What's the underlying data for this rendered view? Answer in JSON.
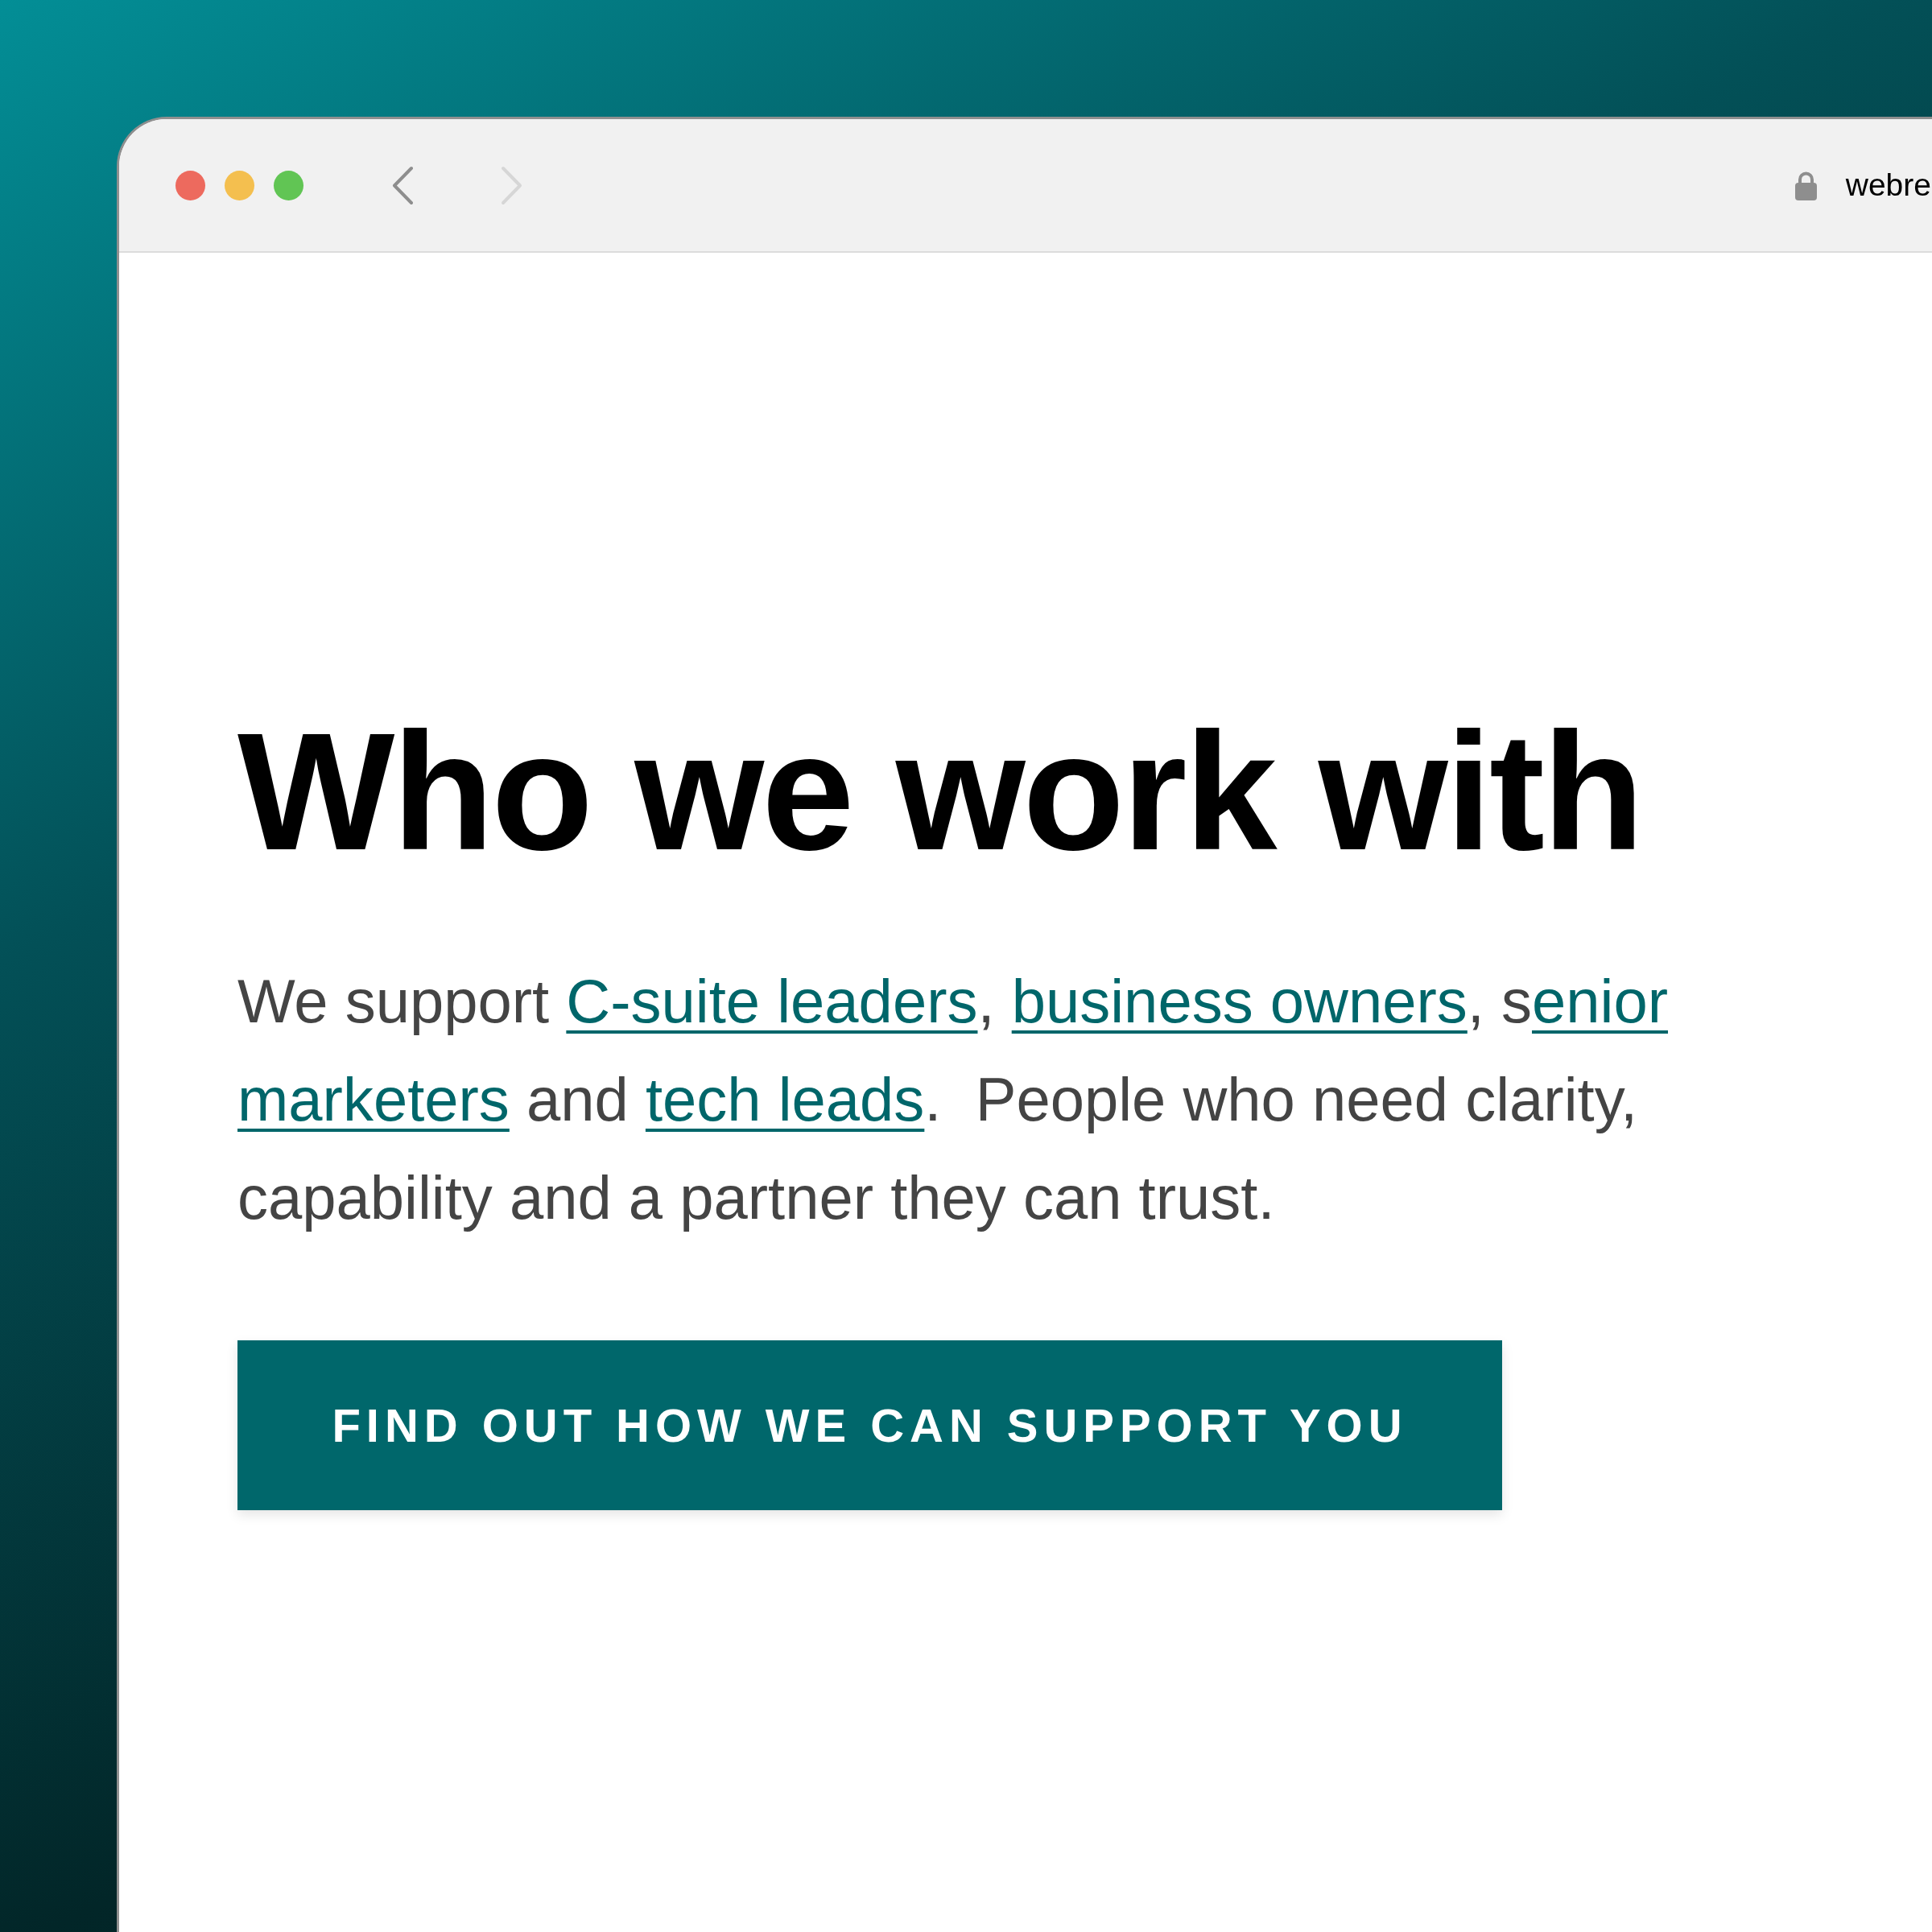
{
  "browser": {
    "traffic_lights": [
      {
        "color": "#ed6a5e"
      },
      {
        "color": "#f4bf4f"
      },
      {
        "color": "#61c554"
      }
    ],
    "back": {
      "disabled": false
    },
    "forward": {
      "disabled": true
    },
    "address": {
      "url": "webre"
    }
  },
  "content": {
    "heading": "Who we work with",
    "paragraph": [
      {
        "kind": "text",
        "text": "We support "
      },
      {
        "kind": "link",
        "text": "C-suite leaders"
      },
      {
        "kind": "text",
        "text": ", "
      },
      {
        "kind": "link",
        "text": "business owners"
      },
      {
        "kind": "text",
        "text": ", s"
      },
      {
        "kind": "link",
        "text": "enior "
      },
      {
        "kind": "link",
        "text": "marketers"
      },
      {
        "kind": "text",
        "text": " and "
      },
      {
        "kind": "link",
        "text": "tech leads"
      },
      {
        "kind": "text",
        "text": ".  People who need clarity, capability and a partner they can trust."
      }
    ],
    "button": "FIND OUT HOW WE CAN SUPPORT YOU"
  }
}
